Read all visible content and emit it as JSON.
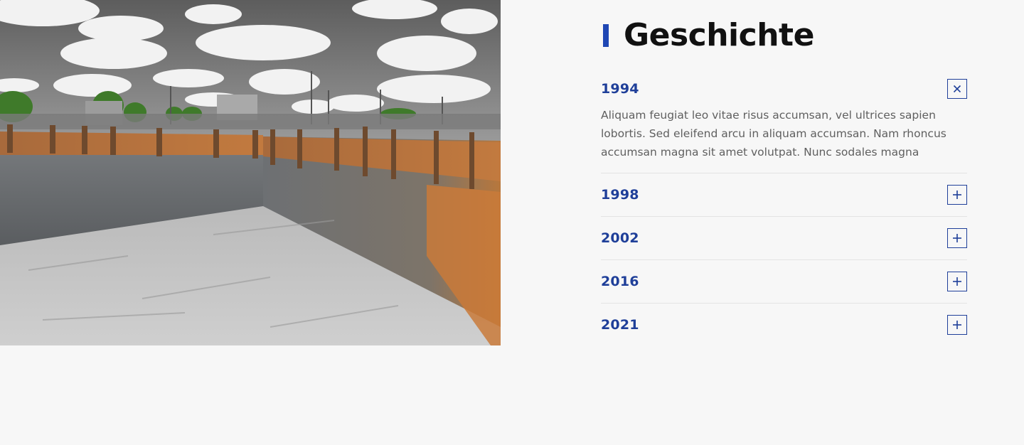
{
  "section": {
    "title": "Geschichte",
    "accent_color": "#1f47b4"
  },
  "accordion": {
    "items": [
      {
        "year": "1994",
        "expanded": true,
        "toggle_icon": "close-icon",
        "text": "Aliquam feugiat leo vitae risus accumsan, vel ultrices sapien lobortis. Sed eleifend arcu in aliquam accumsan. Nam rhoncus accumsan magna sit amet volutpat. Nunc sodales magna"
      },
      {
        "year": "1998",
        "expanded": false,
        "toggle_icon": "plus-icon"
      },
      {
        "year": "2002",
        "expanded": false,
        "toggle_icon": "plus-icon"
      },
      {
        "year": "2016",
        "expanded": false,
        "toggle_icon": "plus-icon"
      },
      {
        "year": "2021",
        "expanded": false,
        "toggle_icon": "plus-icon"
      }
    ],
    "year_color": "#1f3f99"
  }
}
